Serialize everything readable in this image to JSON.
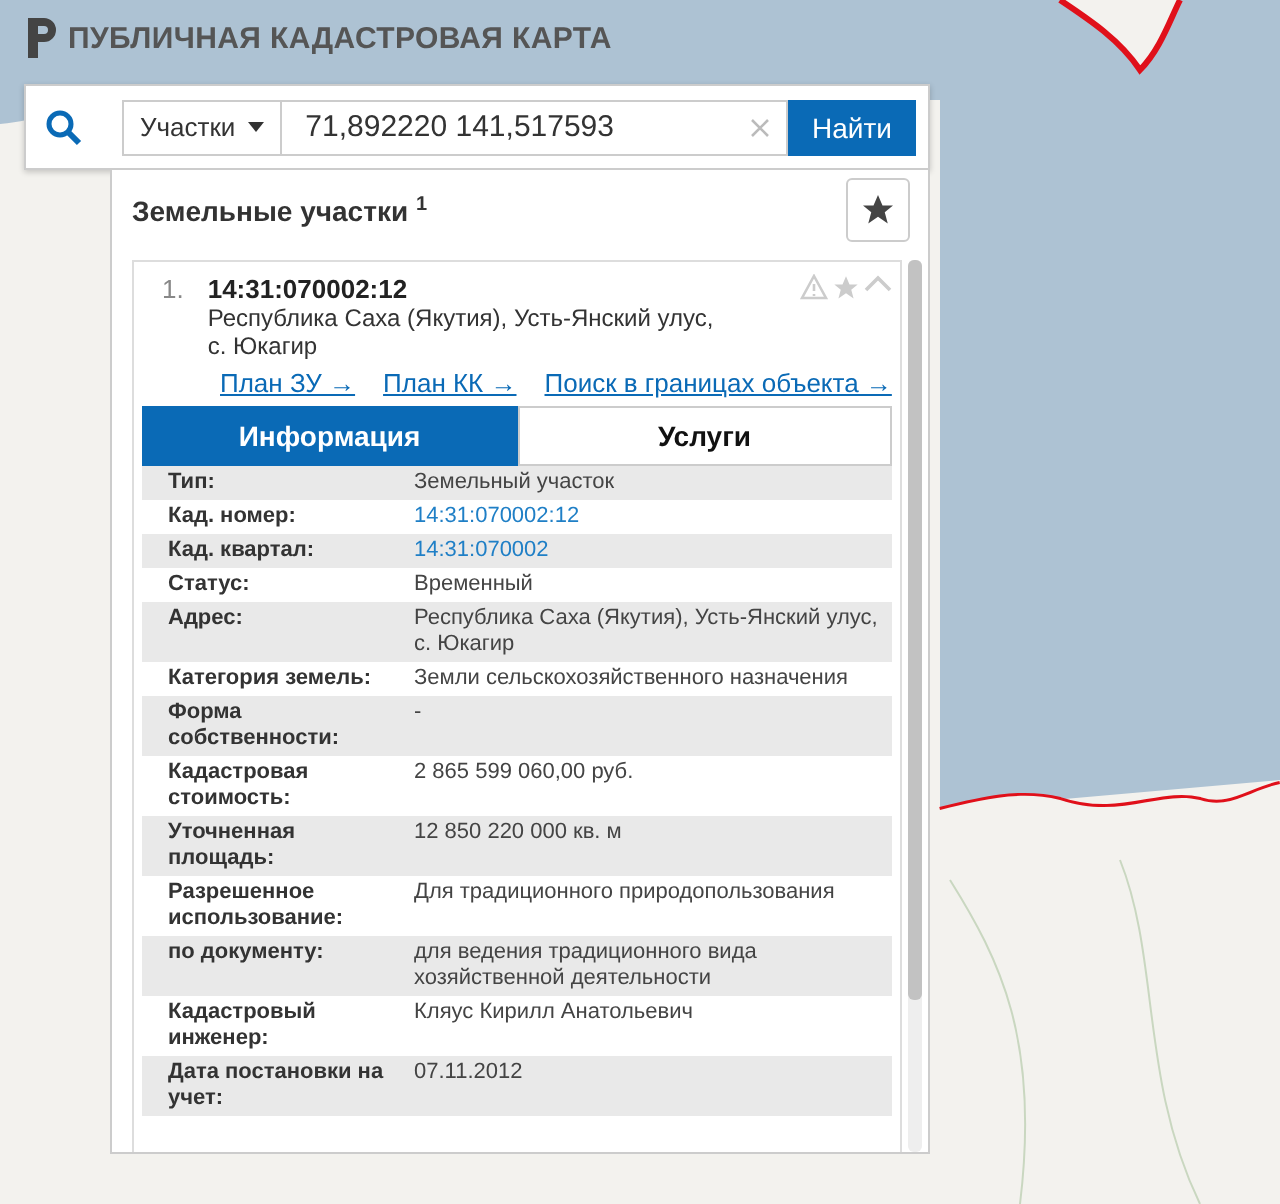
{
  "header": {
    "title": "ПУБЛИЧНАЯ КАДАСТРОВАЯ КАРТА"
  },
  "search": {
    "category": "Участки",
    "value": "71,892220 141,517593",
    "button": "Найти"
  },
  "results": {
    "title": "Земельные участки $^{1}$",
    "item": {
      "index": "1.",
      "number": "14:31:070002:12",
      "address": "Республика Саха (Якутия), Усть-Янский улус, с. Юкагир",
      "expanded": true,
      "links": [
        "План ЗУ →",
        "План КК →",
        "Поиск в границах объекта →"
      ],
      "tabs": [
        {
          "label": "Информация",
          "selected": true
        },
        {
          "label": "Услуги",
          "selected": false
        }
      ],
      "rows": [
        {
          "label": "Тип:",
          "value": "Земельный участок",
          "kind": "text"
        },
        {
          "label": "Кад. номер:",
          "value": "14:31:070002:12",
          "kind": "link"
        },
        {
          "label": "Кад. квартал:",
          "value": "14:31:070002",
          "kind": "link"
        },
        {
          "label": "Статус:",
          "value": "Временный",
          "kind": "text"
        },
        {
          "label": "Адрес:",
          "value": "Республика Саха (Якутия), Усть-Янский улус, с. Юкагир",
          "kind": "text"
        },
        {
          "label": "Категория земель:",
          "value": "Земли сельскохозяйственного назначения",
          "kind": "text"
        },
        {
          "label": "Форма собственности:",
          "value": "-",
          "kind": "text"
        },
        {
          "label": "Кадастровая стоимость:",
          "value": "2 865 599 060,00 руб.",
          "kind": "text"
        },
        {
          "label": "Уточненная площадь:",
          "value": "12 850 220 000 кв. м",
          "kind": "text"
        },
        {
          "label": "Разрешенное использование:",
          "value": "Для традиционного природопользования",
          "kind": "text"
        },
        {
          "label": "по документу:",
          "value": "для ведения традиционного вида хозяйственной деятельности",
          "kind": "text"
        },
        {
          "label": "Кадастровый инженер:",
          "value": "Кляус Кирилл Анатольевич",
          "kind": "text"
        },
        {
          "label": "Дата постановки на учет:",
          "value": "07.11.2012",
          "kind": "text"
        }
      ]
    }
  }
}
